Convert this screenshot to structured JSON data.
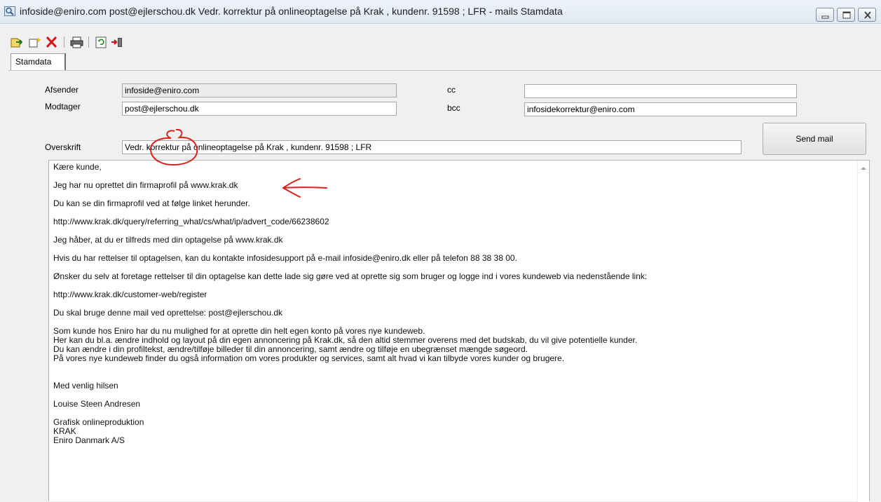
{
  "window": {
    "title": "infoside@eniro.com post@ejlerschou.dk Vedr. korrektur på onlineoptagelse på Krak , kundenr. 91598 ; LFR - mails Stamdata"
  },
  "toolbar": {
    "icons": [
      "open-record-icon",
      "new-record-icon",
      "delete-icon",
      "print-icon",
      "refresh-icon",
      "exit-icon"
    ]
  },
  "tabs": [
    {
      "label": "Stamdata",
      "active": true
    }
  ],
  "form": {
    "afsender_label": "Afsender",
    "afsender_value": "infoside@eniro.com",
    "modtager_label": "Modtager",
    "modtager_value": "post@ejlerschou.dk",
    "cc_label": "cc",
    "cc_value": "",
    "bcc_label": "bcc",
    "bcc_value": "infosidekorrektur@eniro.com",
    "overskrift_label": "Overskrift",
    "overskrift_value": "Vedr. korrektur på onlineoptagelse på Krak , kundenr. 91598 ; LFR",
    "send_label": "Send mail"
  },
  "mail_body": "Kære kunde,\n\nJeg har nu oprettet din firmaprofil på www.krak.dk\n\nDu kan se din firmaprofil ved at følge linket herunder.\n\nhttp://www.krak.dk/query/referring_what/cs/what/ip/advert_code/66238602\n\nJeg håber, at du er tilfreds med din optagelse på www.krak.dk\n\nHvis du har rettelser til optagelsen, kan du kontakte infosidesupport på e-mail infoside@eniro.dk eller på telefon 88 38 38 00.\n\nØnsker du selv at foretage rettelser til din optagelse kan dette lade sig gøre ved at oprette sig som bruger og logge ind i vores kundeweb via nedenstående link:\n\nhttp://www.krak.dk/customer-web/register\n\nDu skal bruge denne mail ved oprettelse: post@ejlerschou.dk\n\nSom kunde hos Eniro har du nu mulighed for at oprette din helt egen konto på vores nye kundeweb.\nHer kan du bl.a. ændre indhold og layout på din egen annoncering på Krak.dk, så den altid stemmer overens med det budskab, du vil give potentielle kunder.\nDu kan ændre i din profiltekst, ændre/tilføje billeder til din annoncering, samt ændre og tilføje en ubegrænset mængde søgeord.\nPå vores nye kundeweb finder du også information om vores produkter og services, samt alt hvad vi kan tilbyde vores kunder og brugere.\n\n\nMed venlig hilsen\n\nLouise Steen Andresen\n\nGrafisk onlineproduktion\nKRAK\nEniro Danmark A/S",
  "colors": {
    "annotation": "#e0201a",
    "titlebar": "#dfe8f2"
  }
}
